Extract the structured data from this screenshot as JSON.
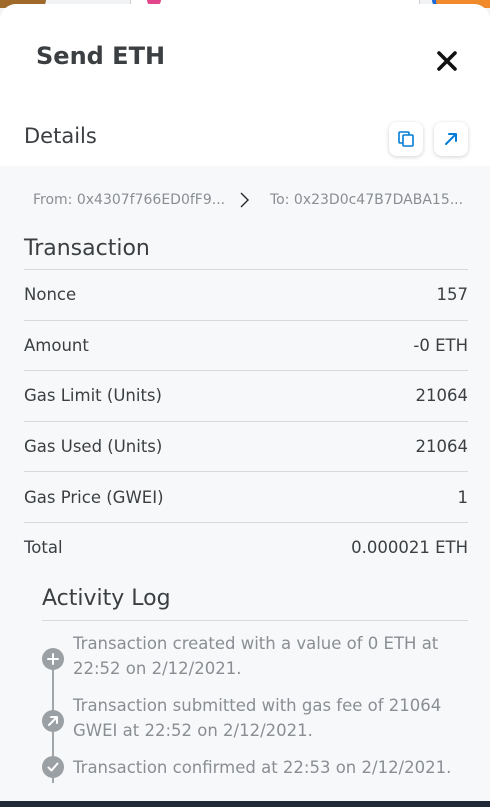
{
  "modal": {
    "title": "Send ETH",
    "close_icon": "close-icon"
  },
  "details": {
    "title": "Details",
    "copy_icon": "copy-icon",
    "explorer_icon": "external-link-icon"
  },
  "addresses": {
    "from": "From: 0x4307f766ED0fF9...",
    "to": "To: 0x23D0c47B7DABA15..."
  },
  "transaction": {
    "title": "Transaction",
    "rows": [
      {
        "label": "Nonce",
        "value": "157"
      },
      {
        "label": "Amount",
        "value": "-0 ETH"
      },
      {
        "label": "Gas Limit (Units)",
        "value": "21064"
      },
      {
        "label": "Gas Used (Units)",
        "value": "21064"
      },
      {
        "label": "Gas Price (GWEI)",
        "value": "1"
      },
      {
        "label": "Total",
        "value": "0.000021 ETH"
      }
    ]
  },
  "activity_log": {
    "title": "Activity Log",
    "items": [
      {
        "icon": "plus-icon",
        "text": "Transaction created with a value of 0 ETH at 22:52 on 2/12/2021."
      },
      {
        "icon": "arrow-up-right-icon",
        "text": "Transaction submitted with gas fee of 21064 GWEI at 22:52 on 2/12/2021."
      },
      {
        "icon": "check-icon",
        "text": "Transaction confirmed at 22:53 on 2/12/2021."
      }
    ]
  },
  "colors": {
    "accent": "#037dd6",
    "text": "#3b3f42",
    "muted": "#8a8e93",
    "divider": "#d6d9dc",
    "panel": "#f7f8f9"
  }
}
